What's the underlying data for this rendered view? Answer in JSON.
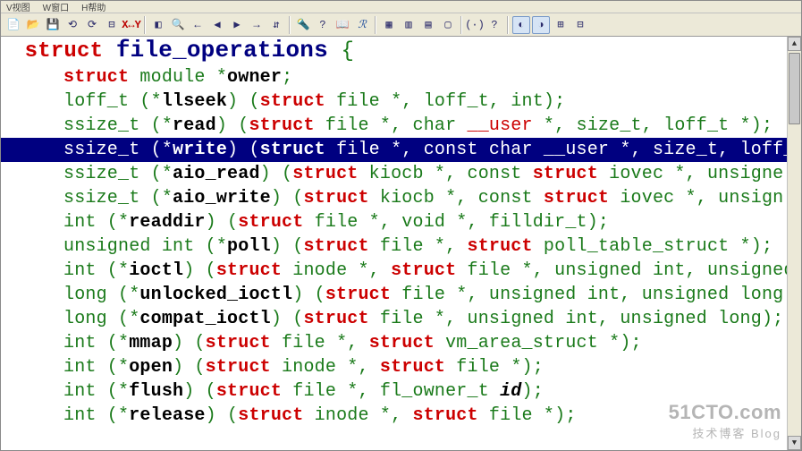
{
  "menu": {
    "items": [
      "V视图",
      "W窗口",
      "H帮助"
    ]
  },
  "toolbar_icons": [
    "📄",
    "📂",
    "💾",
    "⟲",
    "⟳",
    "⊟",
    "X↔Y",
    "",
    "◧",
    "🔍",
    "←",
    "◀",
    "▶",
    "→",
    "⇵",
    "",
    "🔦",
    "?",
    "📖",
    "ℛ",
    "",
    "▦",
    "▥",
    "▤",
    "▢",
    "",
    "(·)",
    "?",
    "",
    "◐",
    "◑",
    "⊞",
    "⊟"
  ],
  "watermark": {
    "url": "51CTO.com",
    "sub": "技术博客    Blog"
  },
  "code": {
    "l0": {
      "kw": "struct",
      "name": "file_operations",
      "brace": " {"
    },
    "l1": {
      "kw": "struct",
      "t1": " module *",
      "fn": "owner",
      "suf": ";"
    },
    "l2": {
      "t1": "loff_t (*",
      "fn": "llseek",
      "p1": ") (",
      "kw": "struct",
      "p2": " file *, loff_t, int);"
    },
    "l3": {
      "t1": "ssize_t (*",
      "fn": "read",
      "p1": ") (",
      "kw": "struct",
      "p2": " file *, char ",
      "u": "__user",
      "p3": " *, size_t, loff_t *);"
    },
    "l4": {
      "t1": "ssize_t (*",
      "fn": "write",
      "p1": ") (",
      "kw": "struct",
      "p2": " file *, const char ",
      "u": "__user",
      "p3": " *, size_t, loff_t *"
    },
    "l5": {
      "t1": "ssize_t (*",
      "fn": "aio_read",
      "p1": ") (",
      "kw1": "struct",
      "p2": " kiocb *, const ",
      "kw2": "struct",
      "p3": " iovec *, unsigne"
    },
    "l6": {
      "t1": "ssize_t (*",
      "fn": "aio_write",
      "p1": ") (",
      "kw1": "struct",
      "p2": " kiocb *, const ",
      "kw2": "struct",
      "p3": " iovec *, unsign"
    },
    "l7": {
      "t1": "int (*",
      "fn": "readdir",
      "p1": ") (",
      "kw": "struct",
      "p2": " file *, void *, filldir_t);"
    },
    "l8": {
      "t1": "unsigned int (*",
      "fn": "poll",
      "p1": ") (",
      "kw1": "struct",
      "p2": " file *, ",
      "kw2": "struct",
      "p3": " poll_table_struct *);"
    },
    "l9": {
      "t1": "int (*",
      "fn": "ioctl",
      "p1": ") (",
      "kw1": "struct",
      "p2": " inode *, ",
      "kw2": "struct",
      "p3": " file *, unsigned int, unsigned lo"
    },
    "l10": {
      "t1": "long (*",
      "fn": "unlocked_ioctl",
      "p1": ") (",
      "kw": "struct",
      "p2": " file *, unsigned int, unsigned long"
    },
    "l11": {
      "t1": "long (*",
      "fn": "compat_ioctl",
      "p1": ") (",
      "kw": "struct",
      "p2": " file *, unsigned int, unsigned long);"
    },
    "l12": {
      "t1": "int (*",
      "fn": "mmap",
      "p1": ") (",
      "kw1": "struct",
      "p2": " file *, ",
      "kw2": "struct",
      "p3": " vm_area_struct *);"
    },
    "l13": {
      "t1": "int (*",
      "fn": "open",
      "p1": ") (",
      "kw1": "struct",
      "p2": " inode *, ",
      "kw2": "struct",
      "p3": " file *);"
    },
    "l14": {
      "t1": "int (*",
      "fn": "flush",
      "p1": ") (",
      "kw": "struct",
      "p2": " file *, fl_owner_t ",
      "id": "id",
      "p3": ");"
    },
    "l15": {
      "t1": "int (*",
      "fn": "release",
      "p1": ") (",
      "kw1": "struct",
      "p2": " inode *, ",
      "kw2": "struct",
      "p3": " file *);"
    }
  }
}
